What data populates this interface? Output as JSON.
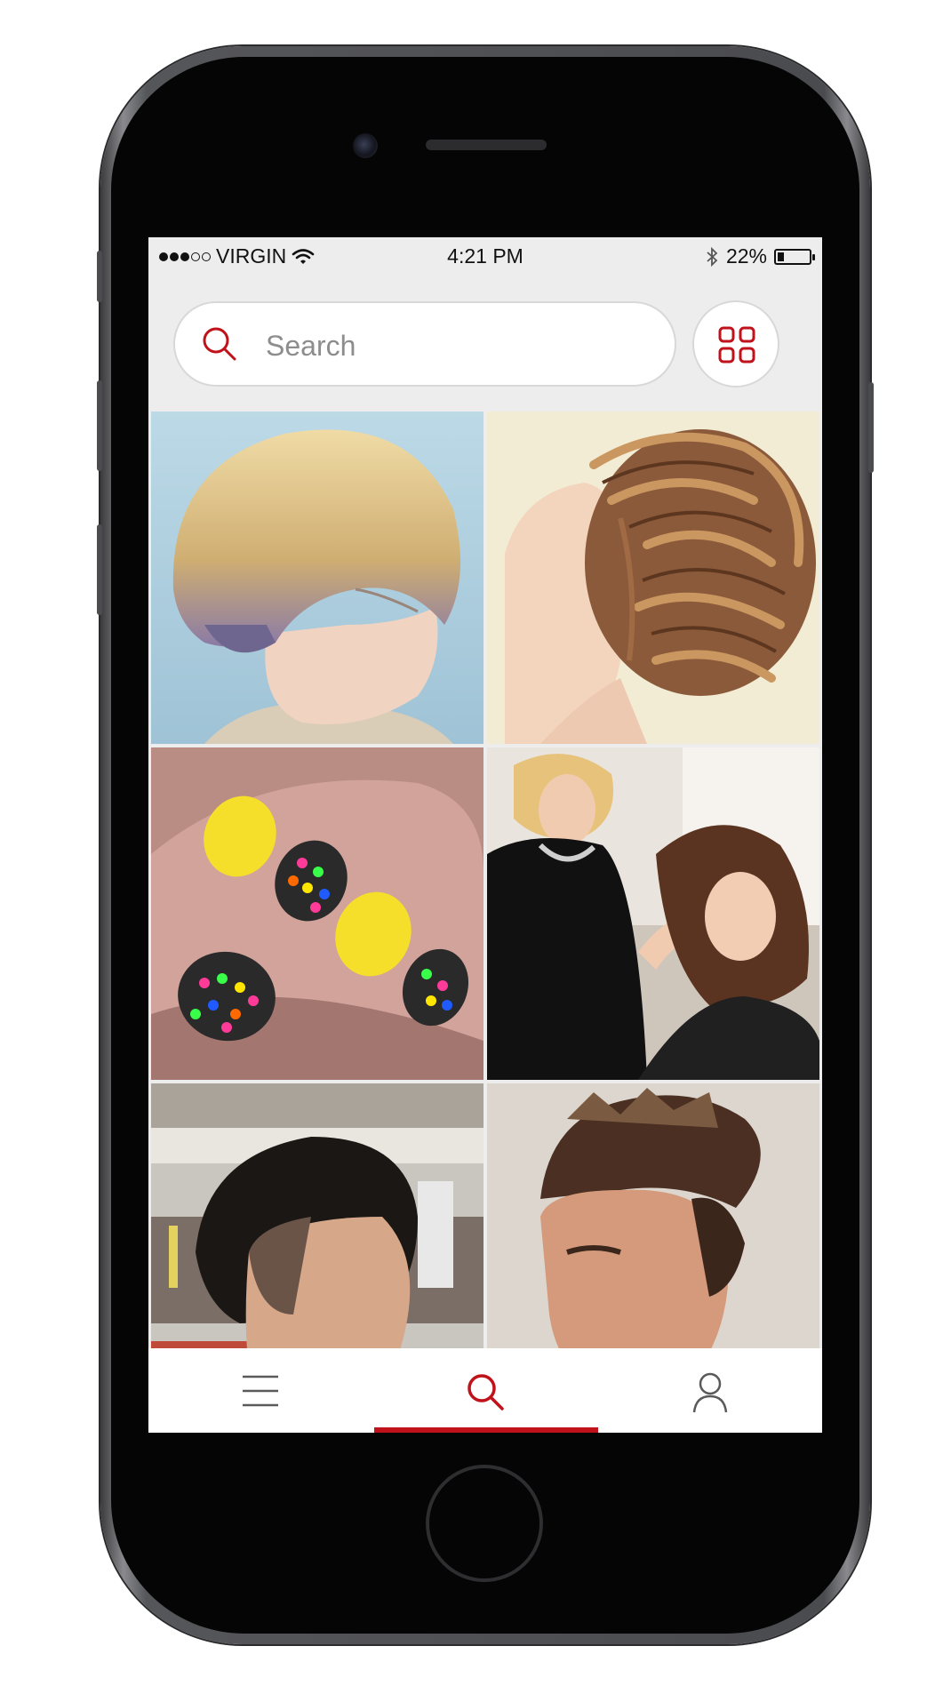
{
  "status_bar": {
    "carrier": "VIRGIN",
    "time": "4:21 PM",
    "battery_text": "22%",
    "battery_level": 0.22,
    "signal_bars_filled": 3,
    "signal_bars_total": 5
  },
  "search": {
    "placeholder": "Search",
    "value": ""
  },
  "gallery": {
    "items": [
      "short blonde bob haircut with lavender underlayer",
      "braided crown updo",
      "yellow and confetti polka dot nail art",
      "stylist curling client's hair in salon",
      "men's pompadour fade in barbershop",
      "men's spiky quiff hairstyle"
    ]
  },
  "tab_bar": {
    "tabs": [
      {
        "name": "menu",
        "icon": "menu-icon",
        "active": false
      },
      {
        "name": "search",
        "icon": "search-icon",
        "active": true
      },
      {
        "name": "profile",
        "icon": "user-icon",
        "active": false
      }
    ]
  },
  "colors": {
    "accent": "#c0121b",
    "screen_bg": "#ededed",
    "icon_gray": "#5a5a5a"
  }
}
